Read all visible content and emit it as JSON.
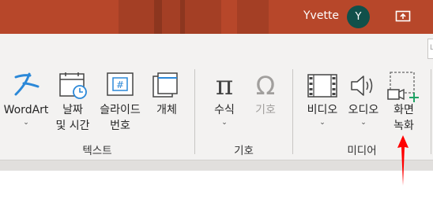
{
  "titlebar": {
    "user_name": "Yvette",
    "avatar_initial": "Y",
    "bg_color": "#b7472a",
    "avatar_color": "#10504a"
  },
  "ribbon": {
    "groups": [
      {
        "label": "텍스트",
        "buttons": [
          {
            "line1": "WordArt",
            "chevron": "⌄",
            "icon": "wordart-icon"
          },
          {
            "line1": "날짜",
            "line2": "및 시간",
            "icon": "calendar-clock-icon"
          },
          {
            "line1": "슬라이드",
            "line2": "번호",
            "icon": "slide-number-icon"
          },
          {
            "line1": "개체",
            "icon": "object-icon"
          }
        ]
      },
      {
        "label": "기호",
        "buttons": [
          {
            "line1": "수식",
            "chevron": "⌄",
            "icon": "pi-equation-icon",
            "symbol": "π"
          },
          {
            "line1": "기호",
            "disabled": true,
            "icon": "omega-symbol-icon",
            "symbol": "Ω"
          }
        ]
      },
      {
        "label": "미디어",
        "buttons": [
          {
            "line1": "비디오",
            "chevron": "⌄",
            "icon": "video-film-icon"
          },
          {
            "line1": "오디오",
            "chevron": "⌄",
            "icon": "speaker-icon"
          },
          {
            "line1": "화면",
            "line2": "녹화",
            "icon": "screen-recording-icon"
          }
        ]
      }
    ]
  },
  "annotation": {
    "arrow_color": "#ff0000"
  }
}
